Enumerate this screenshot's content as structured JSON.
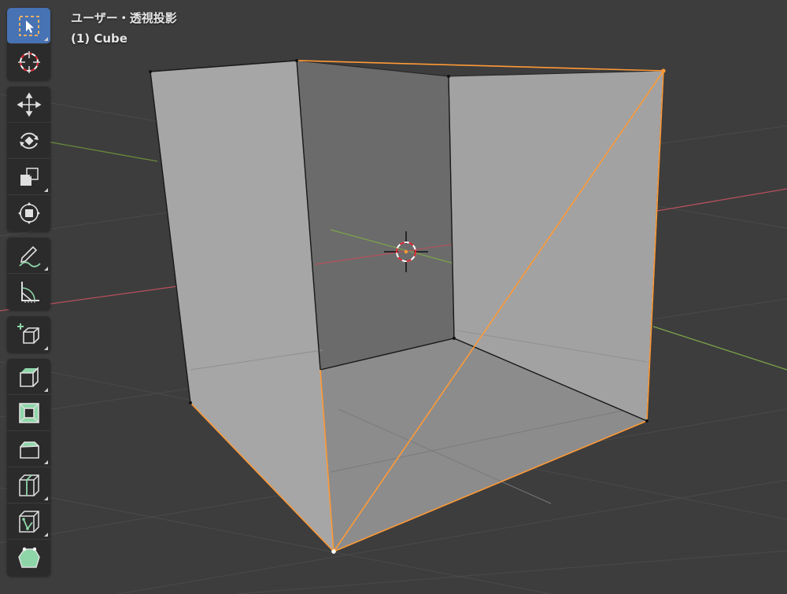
{
  "viewport": {
    "view_mode": "ユーザー・透視投影",
    "object_label": "(1) Cube"
  },
  "colors": {
    "background": "#3d3d3d",
    "toolbar_bg": "#2b2b2b",
    "active_tool": "#4772b3",
    "selection_orange": "#ff9a36",
    "face_light": "#a6a6a6",
    "face_dark": "#6b6b6b",
    "axis_x": "#c44c57",
    "axis_y": "#7ea34a",
    "tool_green": "#8ed6a8"
  },
  "toolbar": {
    "groups": [
      {
        "tools": [
          {
            "id": "select-box",
            "icon": "select-box-icon",
            "active": true
          },
          {
            "id": "cursor",
            "icon": "cursor-icon",
            "active": false
          }
        ]
      },
      {
        "tools": [
          {
            "id": "move",
            "icon": "move-icon"
          },
          {
            "id": "rotate",
            "icon": "rotate-icon"
          },
          {
            "id": "scale",
            "icon": "scale-icon"
          },
          {
            "id": "transform",
            "icon": "transform-icon"
          }
        ]
      },
      {
        "tools": [
          {
            "id": "annotate",
            "icon": "annotate-icon"
          },
          {
            "id": "measure",
            "icon": "measure-icon"
          }
        ]
      },
      {
        "tools": [
          {
            "id": "add-cube",
            "icon": "add-cube-icon"
          }
        ]
      },
      {
        "tools": [
          {
            "id": "extrude",
            "icon": "extrude-icon"
          },
          {
            "id": "inset",
            "icon": "inset-icon"
          },
          {
            "id": "bevel",
            "icon": "bevel-icon"
          },
          {
            "id": "loop-cut",
            "icon": "loop-cut-icon"
          },
          {
            "id": "knife",
            "icon": "knife-icon"
          },
          {
            "id": "poly-build",
            "icon": "poly-build-icon"
          }
        ]
      }
    ]
  }
}
